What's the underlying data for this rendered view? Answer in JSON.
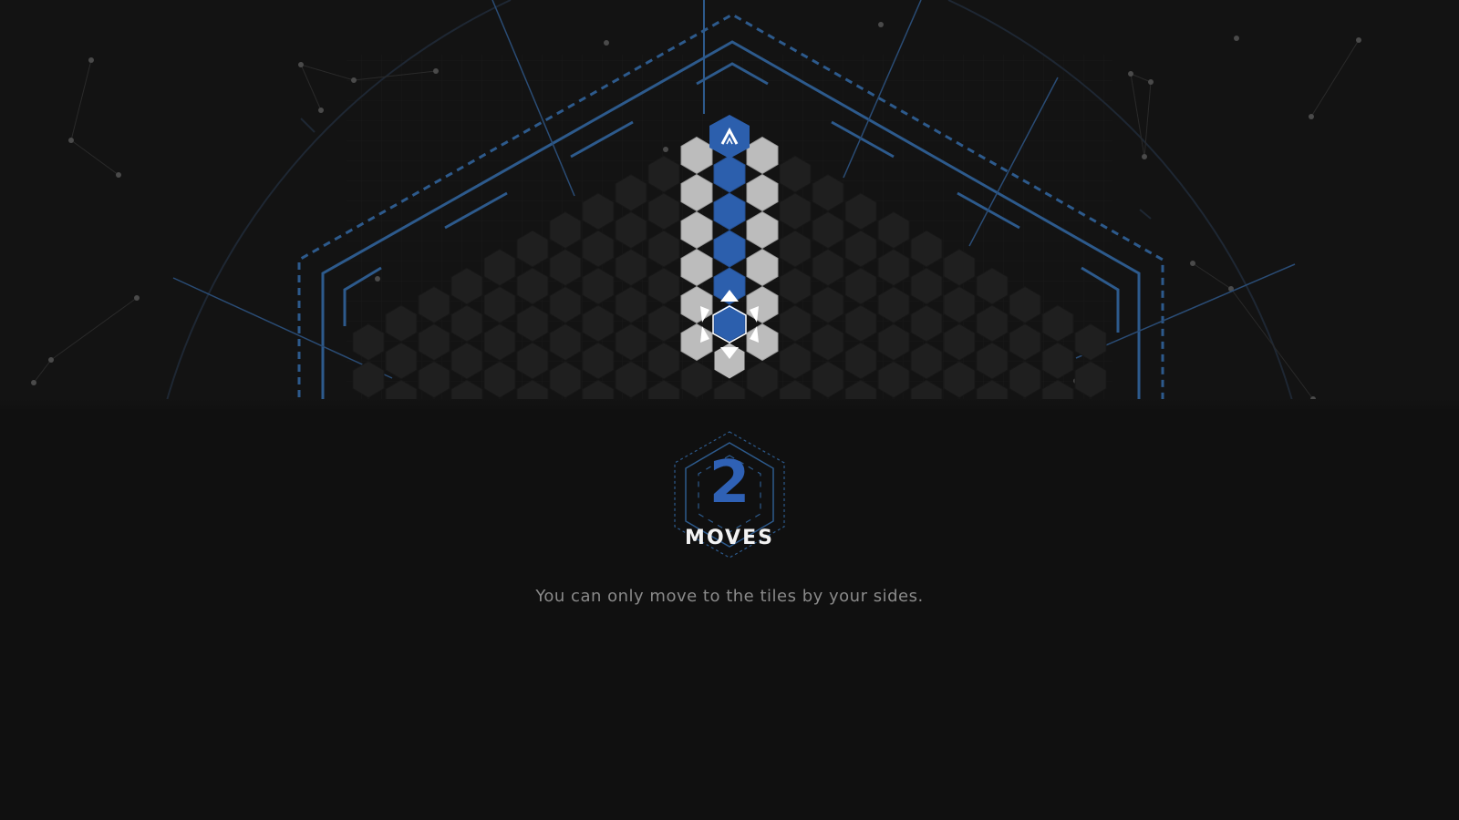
{
  "hud": {
    "moves_count": "2",
    "moves_label": "MOVES",
    "hint_text": "You can only move to the tiles by your sides."
  },
  "board": {
    "player_icon": "chevron-up-icon",
    "selector_icon": "hex-selector-arrows-icon",
    "path_length": 6,
    "colors": {
      "background": "#131313",
      "tile_dark": "#1f1f1f",
      "tile_highlight": "#bcbcbc",
      "tile_path": "#2c5fad",
      "frame_blue": "#2d5a8c",
      "accent_white": "#ffffff"
    }
  }
}
